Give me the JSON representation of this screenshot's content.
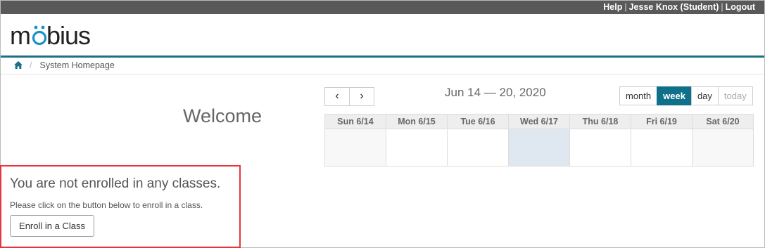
{
  "topbar": {
    "help": "Help",
    "user": "Jesse Knox (Student)",
    "logout": "Logout",
    "separator": "|"
  },
  "logo": {
    "text": "möbius",
    "accent_color": "#1e90c8"
  },
  "breadcrumb": {
    "home_icon": "home-icon",
    "current": "System Homepage"
  },
  "welcome": "Welcome",
  "calendar": {
    "prev_icon": "chevron-left-icon",
    "next_icon": "chevron-right-icon",
    "prev_glyph": "‹",
    "next_glyph": "›",
    "range": "Jun 14 — 20, 2020",
    "views": {
      "month": "month",
      "week": "week",
      "day": "day",
      "today": "today"
    },
    "active_view": "week",
    "days": [
      "Sun 6/14",
      "Mon 6/15",
      "Tue 6/16",
      "Wed 6/17",
      "Thu 6/18",
      "Fri 6/19",
      "Sat 6/20"
    ],
    "today_color": "#dfe8f0"
  },
  "enroll": {
    "title": "You are not enrolled in any classes.",
    "text": "Please click on the button below to enroll in a class.",
    "button": "Enroll in a Class",
    "highlight_color": "#e8343e"
  },
  "colors": {
    "topbar": "#595959",
    "brand": "#10708a"
  }
}
